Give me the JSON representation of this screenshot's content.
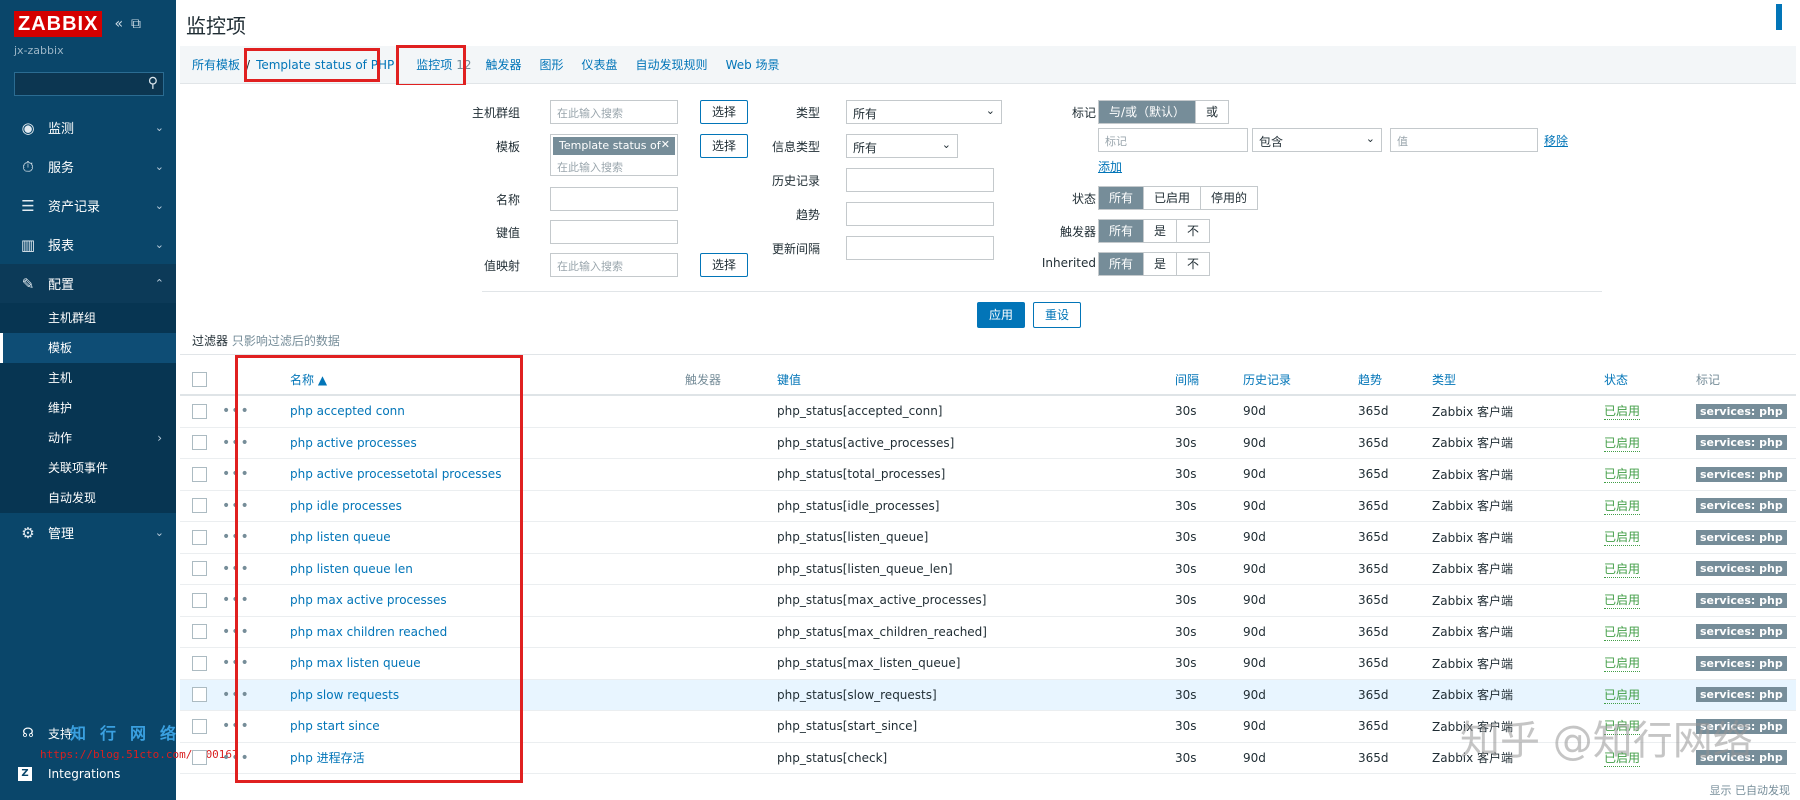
{
  "sidebar": {
    "logo": "ZABBIX",
    "collapse_icon": "«",
    "expand_icon": "⧉",
    "host": "jx-zabbix",
    "menu": [
      {
        "label": "监测",
        "icon": "eye-icon",
        "glyph": "◉"
      },
      {
        "label": "服务",
        "icon": "clock-icon",
        "glyph": "⏱"
      },
      {
        "label": "资产记录",
        "icon": "list-icon",
        "glyph": "☰"
      },
      {
        "label": "报表",
        "icon": "chart-icon",
        "glyph": "▥"
      },
      {
        "label": "配置",
        "icon": "wrench-icon",
        "glyph": "🔧"
      }
    ],
    "submenu": [
      "主机群组",
      "模板",
      "主机",
      "维护",
      "动作",
      "关联项事件",
      "自动发现"
    ],
    "admin": {
      "label": "管理",
      "glyph": "⚙"
    },
    "support": "支持",
    "integrations": "Integrations"
  },
  "page": {
    "title": "监控项"
  },
  "navbar": {
    "all_templates": "所有模板",
    "template": "Template status of PHP",
    "items": "监控项",
    "items_count": "12",
    "triggers": "触发器",
    "graphs": "图形",
    "dashboards": "仪表盘",
    "discovery": "自动发现规则",
    "web": "Web 场景"
  },
  "filter": {
    "host_groups_label": "主机群组",
    "search_placeholder": "在此输入搜索",
    "select_btn": "选择",
    "templates_label": "模板",
    "template_chip": "Template status of ...",
    "name_label": "名称",
    "key_label": "键值",
    "valuemap_label": "值映射",
    "type_label": "类型",
    "type_value": "所有",
    "info_type_label": "信息类型",
    "info_type_value": "所有",
    "history_label": "历史记录",
    "trends_label": "趋势",
    "interval_label": "更新间隔",
    "tags_label": "标记",
    "tag_andor": "与/或（默认）",
    "tag_or": "或",
    "tag_placeholder": "标记",
    "tag_op": "包含",
    "value_placeholder": "值",
    "remove": "移除",
    "add": "添加",
    "state_label": "状态",
    "state_all": "所有",
    "state_enabled": "已启用",
    "state_disabled": "停用的",
    "triggers_label": "触发器",
    "inherited_label": "Inherited",
    "all": "所有",
    "yes": "是",
    "no": "不",
    "apply": "应用",
    "reset": "重设",
    "note_title": "过滤器",
    "note_text": "只影响过滤后的数据"
  },
  "table": {
    "headers": {
      "name": "名称 ▲",
      "triggers": "触发器",
      "key": "键值",
      "interval": "间隔",
      "history": "历史记录",
      "trends": "趋势",
      "type": "类型",
      "status": "状态",
      "tags": "标记"
    },
    "rows": [
      {
        "name": "php accepted conn",
        "key": "php_status[accepted_conn]",
        "interval": "30s",
        "history": "90d",
        "trends": "365d",
        "type": "Zabbix 客户端",
        "status": "已启用",
        "tag": "services: php"
      },
      {
        "name": "php active processes",
        "key": "php_status[active_processes]",
        "interval": "30s",
        "history": "90d",
        "trends": "365d",
        "type": "Zabbix 客户端",
        "status": "已启用",
        "tag": "services: php"
      },
      {
        "name": "php active processetotal processes",
        "key": "php_status[total_processes]",
        "interval": "30s",
        "history": "90d",
        "trends": "365d",
        "type": "Zabbix 客户端",
        "status": "已启用",
        "tag": "services: php"
      },
      {
        "name": "php idle processes",
        "key": "php_status[idle_processes]",
        "interval": "30s",
        "history": "90d",
        "trends": "365d",
        "type": "Zabbix 客户端",
        "status": "已启用",
        "tag": "services: php"
      },
      {
        "name": "php listen queue",
        "key": "php_status[listen_queue]",
        "interval": "30s",
        "history": "90d",
        "trends": "365d",
        "type": "Zabbix 客户端",
        "status": "已启用",
        "tag": "services: php"
      },
      {
        "name": "php listen queue len",
        "key": "php_status[listen_queue_len]",
        "interval": "30s",
        "history": "90d",
        "trends": "365d",
        "type": "Zabbix 客户端",
        "status": "已启用",
        "tag": "services: php"
      },
      {
        "name": "php max active processes",
        "key": "php_status[max_active_processes]",
        "interval": "30s",
        "history": "90d",
        "trends": "365d",
        "type": "Zabbix 客户端",
        "status": "已启用",
        "tag": "services: php"
      },
      {
        "name": "php max children reached",
        "key": "php_status[max_children_reached]",
        "interval": "30s",
        "history": "90d",
        "trends": "365d",
        "type": "Zabbix 客户端",
        "status": "已启用",
        "tag": "services: php"
      },
      {
        "name": "php max listen queue",
        "key": "php_status[max_listen_queue]",
        "interval": "30s",
        "history": "90d",
        "trends": "365d",
        "type": "Zabbix 客户端",
        "status": "已启用",
        "tag": "services: php"
      },
      {
        "name": "php slow requests",
        "key": "php_status[slow_requests]",
        "interval": "30s",
        "history": "90d",
        "trends": "365d",
        "type": "Zabbix 客户端",
        "status": "已启用",
        "tag": "services: php"
      },
      {
        "name": "php start since",
        "key": "php_status[start_since]",
        "interval": "30s",
        "history": "90d",
        "trends": "365d",
        "type": "Zabbix 客户端",
        "status": "已启用",
        "tag": "services: php"
      },
      {
        "name": "php 进程存活",
        "key": "php_status[check]",
        "interval": "30s",
        "history": "90d",
        "trends": "365d",
        "type": "Zabbix 客户端",
        "status": "已启用",
        "tag": "services: php"
      }
    ],
    "dots": "•••"
  },
  "footer": {
    "note": "显示 已自动发现"
  },
  "watermarks": {
    "zhihu": "知乎 @知行网络",
    "blog_url": "https://blog.51cto.com/6300167",
    "brand": "知行网络"
  }
}
